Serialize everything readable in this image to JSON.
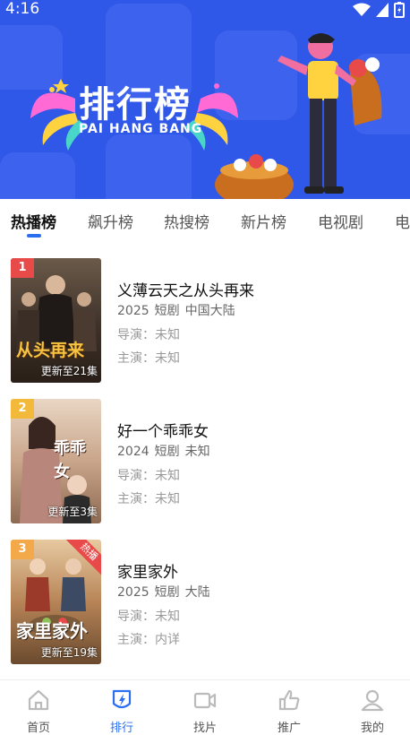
{
  "status_bar": {
    "time": "4:16"
  },
  "banner": {
    "title": "排行榜",
    "subtitle": "PAI HANG BANG"
  },
  "tabs": [
    {
      "label": "热播榜",
      "active": true
    },
    {
      "label": "飙升榜"
    },
    {
      "label": "热搜榜"
    },
    {
      "label": "新片榜"
    },
    {
      "label": "电视剧"
    },
    {
      "label": "电"
    }
  ],
  "items": [
    {
      "rank": "1",
      "rank_color": "#e84a4a",
      "title": "义薄云天之从头再来",
      "year": "2025",
      "genre": "短剧",
      "region": "中国大陆",
      "director": "导演：未知",
      "actor": "主演：未知",
      "update": "更新至21集",
      "poster_text": "从头再来"
    },
    {
      "rank": "2",
      "rank_color": "#f2b93b",
      "title": "好一个乖乖女",
      "year": "2024",
      "genre": "短剧",
      "region": "未知",
      "director": "导演：未知",
      "actor": "主演：未知",
      "update": "更新至3集",
      "poster_text": "乖乖女"
    },
    {
      "rank": "3",
      "rank_color": "#f3a94a",
      "title": "家里家外",
      "year": "2025",
      "genre": "短剧",
      "region": "大陆",
      "director": "导演：未知",
      "actor": "主演：内详",
      "update": "更新至19集",
      "poster_text": "家里家外",
      "ribbon": "热播"
    }
  ],
  "nav": [
    {
      "label": "首页",
      "icon": "home-icon"
    },
    {
      "label": "排行",
      "icon": "ranking-icon",
      "active": true
    },
    {
      "label": "找片",
      "icon": "video-camera-icon"
    },
    {
      "label": "推广",
      "icon": "thumbs-up-icon"
    },
    {
      "label": "我的",
      "icon": "user-icon"
    }
  ],
  "colors": {
    "accent": "#2a6ff0",
    "banner_bg": "#2f57e8"
  }
}
